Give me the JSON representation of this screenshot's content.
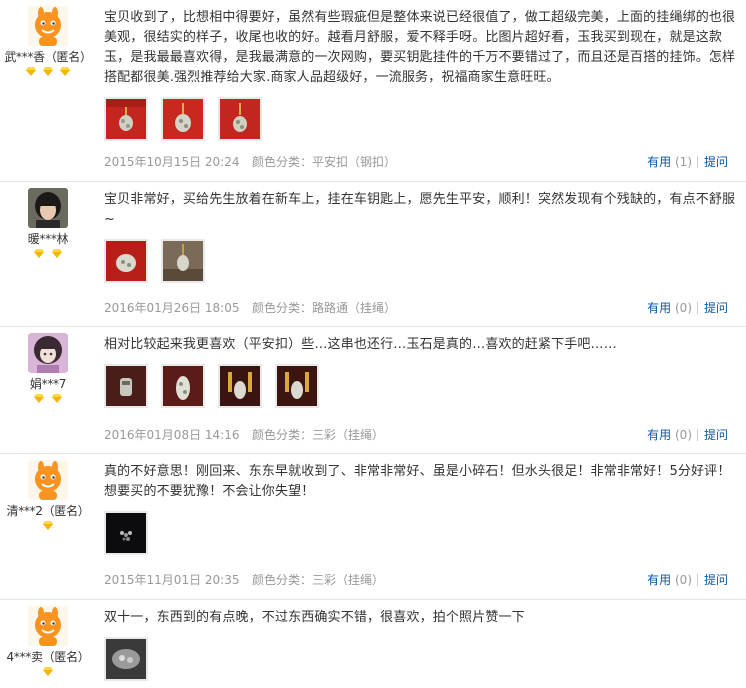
{
  "reviews": [
    {
      "username": "武***香（匿名）",
      "badge_count": 3,
      "avatar": "mascot",
      "text": "宝贝收到了，比想相中得要好，虽然有些瑕疵但是整体来说已经很值了，做工超级完美，上面的挂绳绑的也很美观，很结实的样子，收尾也收的好。越看月舒服，爱不释手呀。比图片超好看，玉我买到现在，就是这款玉，是我最最喜欢得，是我最满意的一次网购，要买钥匙挂件的千万不要错过了，而且还是百搭的挂饰。怎样搭配都很美.强烈推荐给大家.商家人品超级好，一流服务，祝福商家生意旺旺。",
      "photos": [
        "red-photo",
        "red-photo",
        "red-photo"
      ],
      "date": "2015年10月15日 20:24",
      "variant": "颜色分类：平安扣（钢扣）",
      "useful_label": "有用",
      "useful_count": "(1)",
      "ask_label": "提问"
    },
    {
      "username": "暖***林",
      "badge_count": 2,
      "avatar": "girl",
      "text": "宝贝非常好，买给先生放着在新车上，挂在车钥匙上，愿先生平安，顺利！突然发现有个残缺的，有点不舒服~",
      "photos": [
        "red-photo",
        "keychain-photo"
      ],
      "date": "2016年01月26日 18:05",
      "variant": "颜色分类：路路通（挂绳）",
      "useful_label": "有用",
      "useful_count": "(0)",
      "ask_label": "提问"
    },
    {
      "username": "娟***7",
      "badge_count": 2,
      "avatar": "anime-girl",
      "text": "相对比较起来我更喜欢（平安扣）些…这串也还行…玉石是真的…喜欢的赶紧下手吧……",
      "photos": [
        "dark-red-photo",
        "dark-red-photo",
        "gold-photo",
        "gold-photo"
      ],
      "date": "2016年01月08日 14:16",
      "variant": "颜色分类：三彩（挂绳）",
      "useful_label": "有用",
      "useful_count": "(0)",
      "ask_label": "提问"
    },
    {
      "username": "清***2（匿名）",
      "badge_count": 1,
      "avatar": "mascot",
      "text": "真的不好意思！刚回来、东东早就收到了、非常非常好、虽是小碎石！但水头很足！非常非常好！5分好评！想要买的不要犹豫！不会让你失望！",
      "photos": [
        "night-photo"
      ],
      "date": "2015年11月01日 20:35",
      "variant": "颜色分类：三彩（挂绳）",
      "useful_label": "有用",
      "useful_count": "(0)",
      "ask_label": "提问"
    },
    {
      "username": "4***卖（匿名）",
      "badge_count": 1,
      "avatar": "mascot",
      "text": "双十一，东西到的有点晚，不过东西确实不错，很喜欢，拍个照片赞一下",
      "photos": [
        "grey-photo"
      ],
      "date": "",
      "variant": "",
      "useful_label": "",
      "useful_count": "",
      "ask_label": ""
    }
  ]
}
